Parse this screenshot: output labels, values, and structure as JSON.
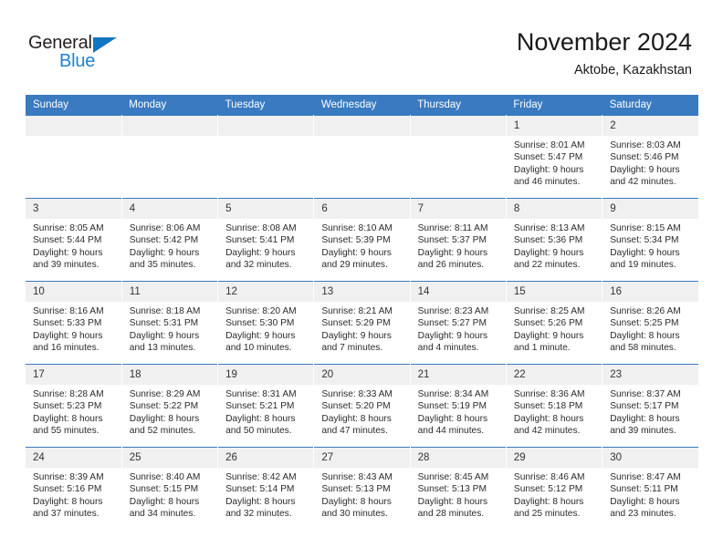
{
  "brand": {
    "name_top": "General",
    "name_bottom": "Blue",
    "accent_color": "#1b81d4"
  },
  "header": {
    "title": "November 2024",
    "subtitle": "Aktobe, Kazakhstan"
  },
  "theme": {
    "header_blue": "#3a7ac0",
    "daynum_bg": "#f0f0f0",
    "text": "#2b2b2b"
  },
  "weekdays": [
    "Sunday",
    "Monday",
    "Tuesday",
    "Wednesday",
    "Thursday",
    "Friday",
    "Saturday"
  ],
  "weeks": [
    [
      {
        "day": "",
        "lines": []
      },
      {
        "day": "",
        "lines": []
      },
      {
        "day": "",
        "lines": []
      },
      {
        "day": "",
        "lines": []
      },
      {
        "day": "",
        "lines": []
      },
      {
        "day": "1",
        "lines": [
          "Sunrise: 8:01 AM",
          "Sunset: 5:47 PM",
          "Daylight: 9 hours",
          "and 46 minutes."
        ]
      },
      {
        "day": "2",
        "lines": [
          "Sunrise: 8:03 AM",
          "Sunset: 5:46 PM",
          "Daylight: 9 hours",
          "and 42 minutes."
        ]
      }
    ],
    [
      {
        "day": "3",
        "lines": [
          "Sunrise: 8:05 AM",
          "Sunset: 5:44 PM",
          "Daylight: 9 hours",
          "and 39 minutes."
        ]
      },
      {
        "day": "4",
        "lines": [
          "Sunrise: 8:06 AM",
          "Sunset: 5:42 PM",
          "Daylight: 9 hours",
          "and 35 minutes."
        ]
      },
      {
        "day": "5",
        "lines": [
          "Sunrise: 8:08 AM",
          "Sunset: 5:41 PM",
          "Daylight: 9 hours",
          "and 32 minutes."
        ]
      },
      {
        "day": "6",
        "lines": [
          "Sunrise: 8:10 AM",
          "Sunset: 5:39 PM",
          "Daylight: 9 hours",
          "and 29 minutes."
        ]
      },
      {
        "day": "7",
        "lines": [
          "Sunrise: 8:11 AM",
          "Sunset: 5:37 PM",
          "Daylight: 9 hours",
          "and 26 minutes."
        ]
      },
      {
        "day": "8",
        "lines": [
          "Sunrise: 8:13 AM",
          "Sunset: 5:36 PM",
          "Daylight: 9 hours",
          "and 22 minutes."
        ]
      },
      {
        "day": "9",
        "lines": [
          "Sunrise: 8:15 AM",
          "Sunset: 5:34 PM",
          "Daylight: 9 hours",
          "and 19 minutes."
        ]
      }
    ],
    [
      {
        "day": "10",
        "lines": [
          "Sunrise: 8:16 AM",
          "Sunset: 5:33 PM",
          "Daylight: 9 hours",
          "and 16 minutes."
        ]
      },
      {
        "day": "11",
        "lines": [
          "Sunrise: 8:18 AM",
          "Sunset: 5:31 PM",
          "Daylight: 9 hours",
          "and 13 minutes."
        ]
      },
      {
        "day": "12",
        "lines": [
          "Sunrise: 8:20 AM",
          "Sunset: 5:30 PM",
          "Daylight: 9 hours",
          "and 10 minutes."
        ]
      },
      {
        "day": "13",
        "lines": [
          "Sunrise: 8:21 AM",
          "Sunset: 5:29 PM",
          "Daylight: 9 hours",
          "and 7 minutes."
        ]
      },
      {
        "day": "14",
        "lines": [
          "Sunrise: 8:23 AM",
          "Sunset: 5:27 PM",
          "Daylight: 9 hours",
          "and 4 minutes."
        ]
      },
      {
        "day": "15",
        "lines": [
          "Sunrise: 8:25 AM",
          "Sunset: 5:26 PM",
          "Daylight: 9 hours",
          "and 1 minute."
        ]
      },
      {
        "day": "16",
        "lines": [
          "Sunrise: 8:26 AM",
          "Sunset: 5:25 PM",
          "Daylight: 8 hours",
          "and 58 minutes."
        ]
      }
    ],
    [
      {
        "day": "17",
        "lines": [
          "Sunrise: 8:28 AM",
          "Sunset: 5:23 PM",
          "Daylight: 8 hours",
          "and 55 minutes."
        ]
      },
      {
        "day": "18",
        "lines": [
          "Sunrise: 8:29 AM",
          "Sunset: 5:22 PM",
          "Daylight: 8 hours",
          "and 52 minutes."
        ]
      },
      {
        "day": "19",
        "lines": [
          "Sunrise: 8:31 AM",
          "Sunset: 5:21 PM",
          "Daylight: 8 hours",
          "and 50 minutes."
        ]
      },
      {
        "day": "20",
        "lines": [
          "Sunrise: 8:33 AM",
          "Sunset: 5:20 PM",
          "Daylight: 8 hours",
          "and 47 minutes."
        ]
      },
      {
        "day": "21",
        "lines": [
          "Sunrise: 8:34 AM",
          "Sunset: 5:19 PM",
          "Daylight: 8 hours",
          "and 44 minutes."
        ]
      },
      {
        "day": "22",
        "lines": [
          "Sunrise: 8:36 AM",
          "Sunset: 5:18 PM",
          "Daylight: 8 hours",
          "and 42 minutes."
        ]
      },
      {
        "day": "23",
        "lines": [
          "Sunrise: 8:37 AM",
          "Sunset: 5:17 PM",
          "Daylight: 8 hours",
          "and 39 minutes."
        ]
      }
    ],
    [
      {
        "day": "24",
        "lines": [
          "Sunrise: 8:39 AM",
          "Sunset: 5:16 PM",
          "Daylight: 8 hours",
          "and 37 minutes."
        ]
      },
      {
        "day": "25",
        "lines": [
          "Sunrise: 8:40 AM",
          "Sunset: 5:15 PM",
          "Daylight: 8 hours",
          "and 34 minutes."
        ]
      },
      {
        "day": "26",
        "lines": [
          "Sunrise: 8:42 AM",
          "Sunset: 5:14 PM",
          "Daylight: 8 hours",
          "and 32 minutes."
        ]
      },
      {
        "day": "27",
        "lines": [
          "Sunrise: 8:43 AM",
          "Sunset: 5:13 PM",
          "Daylight: 8 hours",
          "and 30 minutes."
        ]
      },
      {
        "day": "28",
        "lines": [
          "Sunrise: 8:45 AM",
          "Sunset: 5:13 PM",
          "Daylight: 8 hours",
          "and 28 minutes."
        ]
      },
      {
        "day": "29",
        "lines": [
          "Sunrise: 8:46 AM",
          "Sunset: 5:12 PM",
          "Daylight: 8 hours",
          "and 25 minutes."
        ]
      },
      {
        "day": "30",
        "lines": [
          "Sunrise: 8:47 AM",
          "Sunset: 5:11 PM",
          "Daylight: 8 hours",
          "and 23 minutes."
        ]
      }
    ]
  ]
}
